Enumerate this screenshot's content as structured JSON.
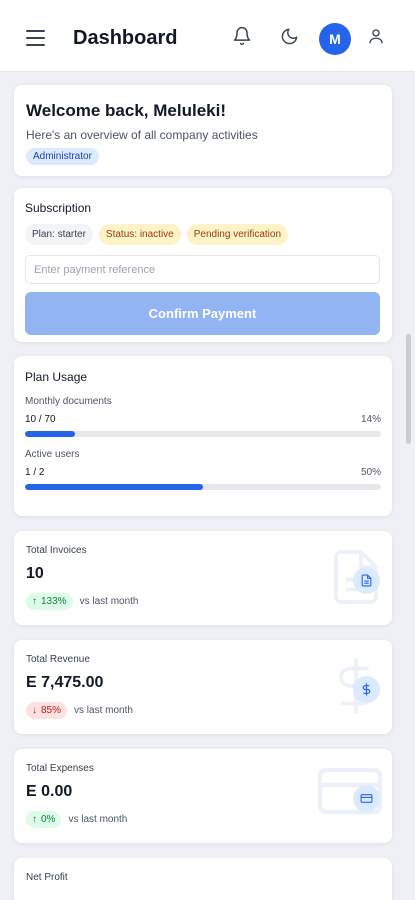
{
  "header": {
    "title": "Dashboard",
    "menu_icon": "hamburger-menu-icon",
    "notification_icon": "bell-icon",
    "theme_icon": "moon-icon",
    "avatar_initial": "M",
    "profile_icon": "user-icon",
    "accent": "#2563eb"
  },
  "welcome": {
    "heading": "Welcome back, Meluleki!",
    "subtitle": "Here's an overview of all company activities",
    "role": "Administrator"
  },
  "subscription": {
    "title": "Subscription",
    "plan_badge": "Plan: starter",
    "status_badge": "Status: inactive",
    "verification_badge": "Pending verification",
    "reference_placeholder": "Enter payment reference",
    "reference_value": "",
    "confirm_label": "Confirm Payment"
  },
  "plan_usage": {
    "title": "Plan Usage",
    "items": [
      {
        "label": "Monthly documents",
        "count": "10 / 70",
        "percent_text": "14%",
        "fill_fraction": 0.14
      },
      {
        "label": "Active users",
        "count": "1 / 2",
        "percent_text": "50%",
        "fill_fraction": 0.5
      }
    ]
  },
  "stats": [
    {
      "name": "Total Invoices",
      "value": "10",
      "trend": "up",
      "change": "133%",
      "compare": "vs last month",
      "icon": "document-icon"
    },
    {
      "name": "Total Revenue",
      "value": "E 7,475.00",
      "trend": "down",
      "change": "85%",
      "compare": "vs last month",
      "icon": "dollar-icon"
    },
    {
      "name": "Total Expenses",
      "value": "E 0.00",
      "trend": "up",
      "change": "0%",
      "compare": "vs last month",
      "icon": "credit-card-icon"
    },
    {
      "name": "Net Profit"
    }
  ]
}
